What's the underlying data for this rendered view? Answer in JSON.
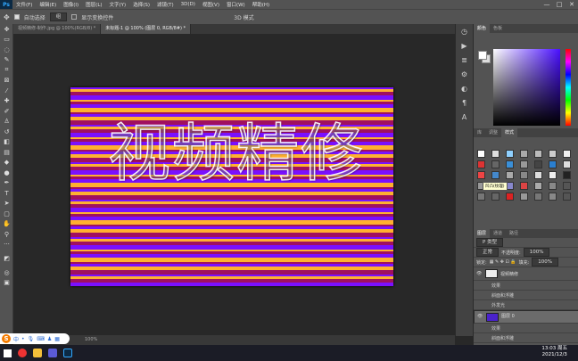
{
  "app": {
    "logo": "Ps"
  },
  "menu": [
    "文件(F)",
    "编辑(E)",
    "图像(I)",
    "图层(L)",
    "文字(Y)",
    "选择(S)",
    "滤镜(T)",
    "3D(D)",
    "视图(V)",
    "窗口(W)",
    "帮助(H)"
  ],
  "window_controls": [
    "—",
    "□",
    "✕"
  ],
  "options": {
    "auto_select": "自动选择",
    "group": "组",
    "show_transform": "显示变换控件",
    "mode_3d": "3D 模式"
  },
  "tabs": [
    {
      "label": "视频精修-制作.jpg @ 100%(RGB/8) *",
      "active": false
    },
    {
      "label": "未标题-1 @ 100% (图层 0, RGB/8#) *",
      "active": true
    }
  ],
  "canvas": {
    "text": "视频精修"
  },
  "status": {
    "zoom": "100%"
  },
  "panels": {
    "color_tabs": [
      "颜色",
      "色板"
    ],
    "styles_tabs": [
      "库",
      "调整",
      "样式"
    ],
    "tooltip": "凹凸(纹理)",
    "layers_tabs": [
      "图层",
      "通道",
      "路径"
    ],
    "layer_kind": "P 类型",
    "blend_mode": "正常",
    "opacity_label": "不透明度:",
    "opacity": "100%",
    "lock_label": "锁定:",
    "fill_label": "填充:",
    "fill": "100%",
    "layers": [
      {
        "name": "视频精修",
        "type": "text",
        "selected": false
      },
      {
        "name": "效果",
        "type": "sub"
      },
      {
        "name": "斜面和浮雕",
        "type": "sub"
      },
      {
        "name": "外发光",
        "type": "sub"
      },
      {
        "name": "图层 0",
        "type": "image",
        "selected": true
      },
      {
        "name": "效果",
        "type": "sub"
      },
      {
        "name": "斜面和浮雕",
        "type": "sub"
      }
    ]
  },
  "taskbar": {
    "time": "13:03 周五",
    "date": "2021/12/3"
  },
  "ime": {
    "logo": "S",
    "label": "中"
  },
  "colors": {
    "accent": "#31a8ff",
    "panel": "#535353",
    "canvas_bg": "#282828"
  }
}
